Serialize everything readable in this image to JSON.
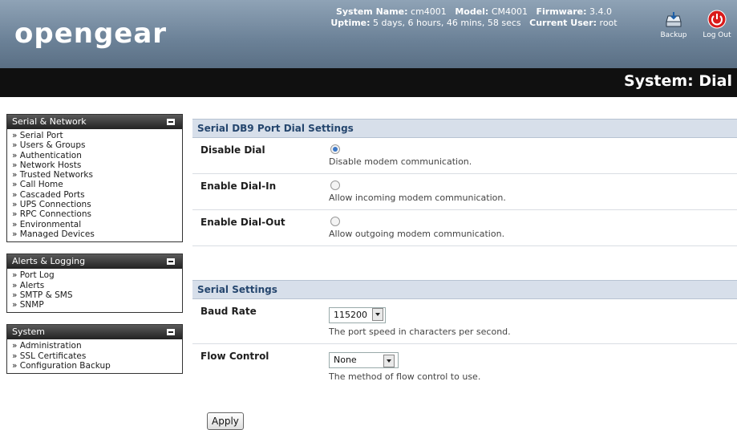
{
  "header": {
    "logo": "opengear",
    "system_name_label": "System Name:",
    "system_name": "cm4001",
    "model_label": "Model:",
    "model": "CM4001",
    "firmware_label": "Firmware:",
    "firmware": "3.4.0",
    "uptime_label": "Uptime:",
    "uptime": "5 days, 6 hours, 46 mins, 58 secs",
    "user_label": "Current User:",
    "user": "root",
    "backup_label": "Backup",
    "logout_label": "Log Out"
  },
  "page_title": "System: Dial",
  "sidebar": {
    "serial_network": {
      "title": "Serial & Network",
      "items": [
        "Serial Port",
        "Users & Groups",
        "Authentication",
        "Network Hosts",
        "Trusted Networks",
        "Call Home",
        "Cascaded Ports",
        "UPS Connections",
        "RPC Connections",
        "Environmental",
        "Managed Devices"
      ]
    },
    "alerts_logging": {
      "title": "Alerts & Logging",
      "items": [
        "Port Log",
        "Alerts",
        "SMTP & SMS",
        "SNMP"
      ]
    },
    "system": {
      "title": "System",
      "items": [
        "Administration",
        "SSL Certificates",
        "Configuration Backup"
      ]
    }
  },
  "dial_settings": {
    "title": "Serial DB9 Port Dial Settings",
    "disable_dial": {
      "label": "Disable Dial",
      "desc": "Disable modem communication.",
      "selected": true
    },
    "enable_dial_in": {
      "label": "Enable Dial-In",
      "desc": "Allow incoming modem communication.",
      "selected": false
    },
    "enable_dial_out": {
      "label": "Enable Dial-Out",
      "desc": "Allow outgoing modem communication.",
      "selected": false
    }
  },
  "serial_settings": {
    "title": "Serial Settings",
    "baud_rate": {
      "label": "Baud Rate",
      "value": "115200",
      "desc": "The port speed in characters per second."
    },
    "flow_control": {
      "label": "Flow Control",
      "value": "None",
      "desc": "The method of flow control to use."
    }
  },
  "apply_label": "Apply",
  "colors": {
    "header": "#6b8197",
    "titlebar": "#101010",
    "section_head": "#d7dfea",
    "section_text": "#25466e"
  }
}
